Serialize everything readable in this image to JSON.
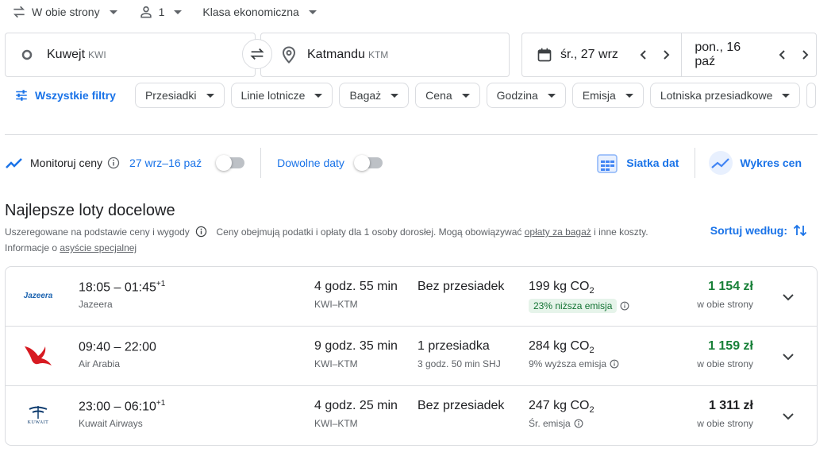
{
  "options": {
    "trip_type": "W obie strony",
    "passengers": "1",
    "cabin": "Klasa ekonomiczna"
  },
  "search": {
    "origin": {
      "city": "Kuwejt",
      "code": "KWI"
    },
    "destination": {
      "city": "Katmandu",
      "code": "KTM"
    },
    "depart_date": "śr., 27 wrz",
    "return_date": "pon., 16 paź"
  },
  "filters": {
    "all_label": "Wszystkie filtry",
    "chips": [
      "Przesiadki",
      "Linie lotnicze",
      "Bagaż",
      "Cena",
      "Godzina",
      "Emisja",
      "Lotniska przesiadkowe"
    ]
  },
  "tracking": {
    "monitor_label": "Monitoruj ceny",
    "date_range": "27 wrz–16 paź",
    "flex_dates_label": "Dowolne daty",
    "date_grid_label": "Siatka dat",
    "price_graph_label": "Wykres cen"
  },
  "section": {
    "title": "Najlepsze loty docelowe",
    "ranking_note": "Uszeregowane na podstawie ceny i wygody",
    "price_note_pre": "Ceny obejmują podatki i opłaty dla 1 osoby dorosłej. Mogą obowiązywać ",
    "price_note_link": "opłaty za bagaż",
    "price_note_post": " i inne koszty.",
    "assist_pre": "Informacje o ",
    "assist_link": "asyście specjalnej",
    "sort_label": "Sortuj według:"
  },
  "flights": [
    {
      "depart": "18:05",
      "arrive": "01:45",
      "day_offset": "+1",
      "airline": "Jazeera",
      "logo": "Jazeera",
      "duration": "4 godz. 55 min",
      "route": "KWI–KTM",
      "stops": "Bez przesiadek",
      "stop_detail": "",
      "co2": "199 kg CO",
      "co2_sub": "2",
      "emission": "23% niższa emisja",
      "price": "1 154 zł",
      "price_type": "w obie strony"
    },
    {
      "depart": "09:40",
      "arrive": "22:00",
      "day_offset": "",
      "airline": "Air Arabia",
      "logo": "",
      "duration": "9 godz. 35 min",
      "route": "KWI–KTM",
      "stops": "1 przesiadka",
      "stop_detail": "3 godz. 50 min SHJ",
      "co2": "284 kg CO",
      "co2_sub": "2",
      "emission": "9% wyższa emisja",
      "price": "1 159 zł",
      "price_type": "w obie strony"
    },
    {
      "depart": "23:00",
      "arrive": "06:10",
      "day_offset": "+1",
      "airline": "Kuwait Airways",
      "logo": "KUWAIT",
      "duration": "4 godz. 25 min",
      "route": "KWI–KTM",
      "stops": "Bez przesiadek",
      "stop_detail": "",
      "co2": "247 kg CO",
      "co2_sub": "2",
      "emission": "Śr. emisja",
      "price": "1 311 zł",
      "price_type": "w obie strony"
    }
  ],
  "colors": {
    "accent": "#1a73e8",
    "price_green": "#188038",
    "emission_tag_bg": "#e6f4ea",
    "air_arabia_red": "#d71a21",
    "jazeera_blue": "#1b63b0"
  }
}
